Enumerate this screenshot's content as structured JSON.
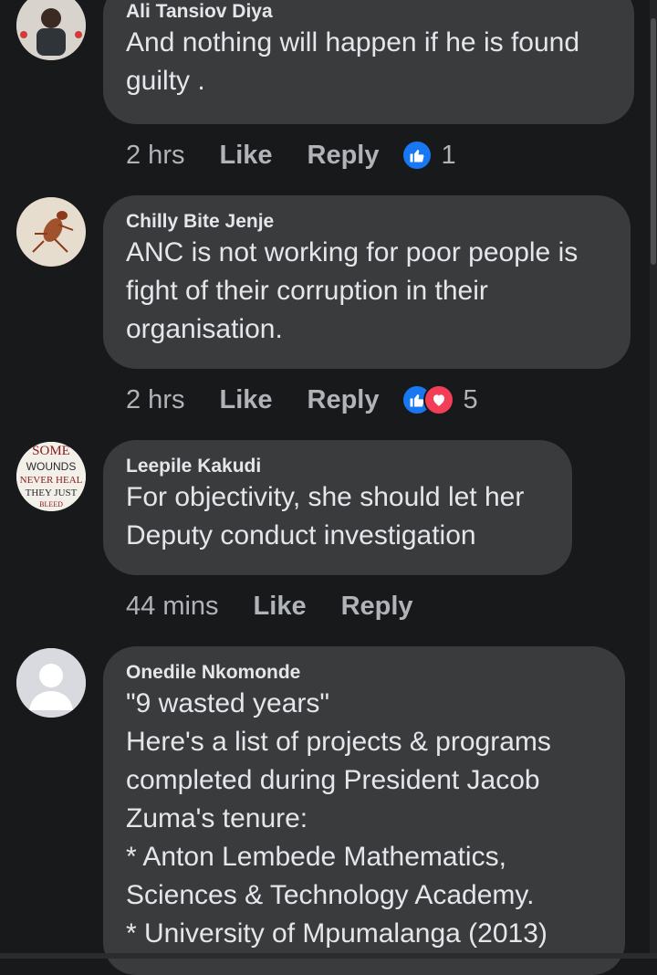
{
  "comments": [
    {
      "author": "Ali Tansiov Diya",
      "text": "And nothing will happen if he is found\nguilty .",
      "time": "2 hrs",
      "like_label": "Like",
      "reply_label": "Reply",
      "reaction_count": "1"
    },
    {
      "author": "Chilly Bite Jenje",
      "text": "ANC is not working for poor people is\nfight of their  corruption in their\norganisation.",
      "time": "2 hrs",
      "like_label": "Like",
      "reply_label": "Reply",
      "reaction_count": "5"
    },
    {
      "author": "Leepile Kakudi",
      "text": "For objectivity, she should let her\nDeputy conduct investigation",
      "time": "44 mins",
      "like_label": "Like",
      "reply_label": "Reply",
      "avatar_text": [
        "SOME",
        "WOUNDS",
        "NEVER HEAL",
        "THEY JUST",
        "BLEED"
      ]
    },
    {
      "author": "Onedile Nkomonde",
      "text": "\"9 wasted years\"\nHere's a list of projects & programs\ncompleted during President Jacob\nZuma's tenure:\n* Anton Lembede Mathematics,\nSciences & Technology Academy.\n* University of Mpumalanga (2013)"
    }
  ],
  "colors": {
    "background": "#18191a",
    "bubble": "#3a3b3c",
    "like_blue": "#1877f2",
    "love_red": "#f33e58"
  }
}
